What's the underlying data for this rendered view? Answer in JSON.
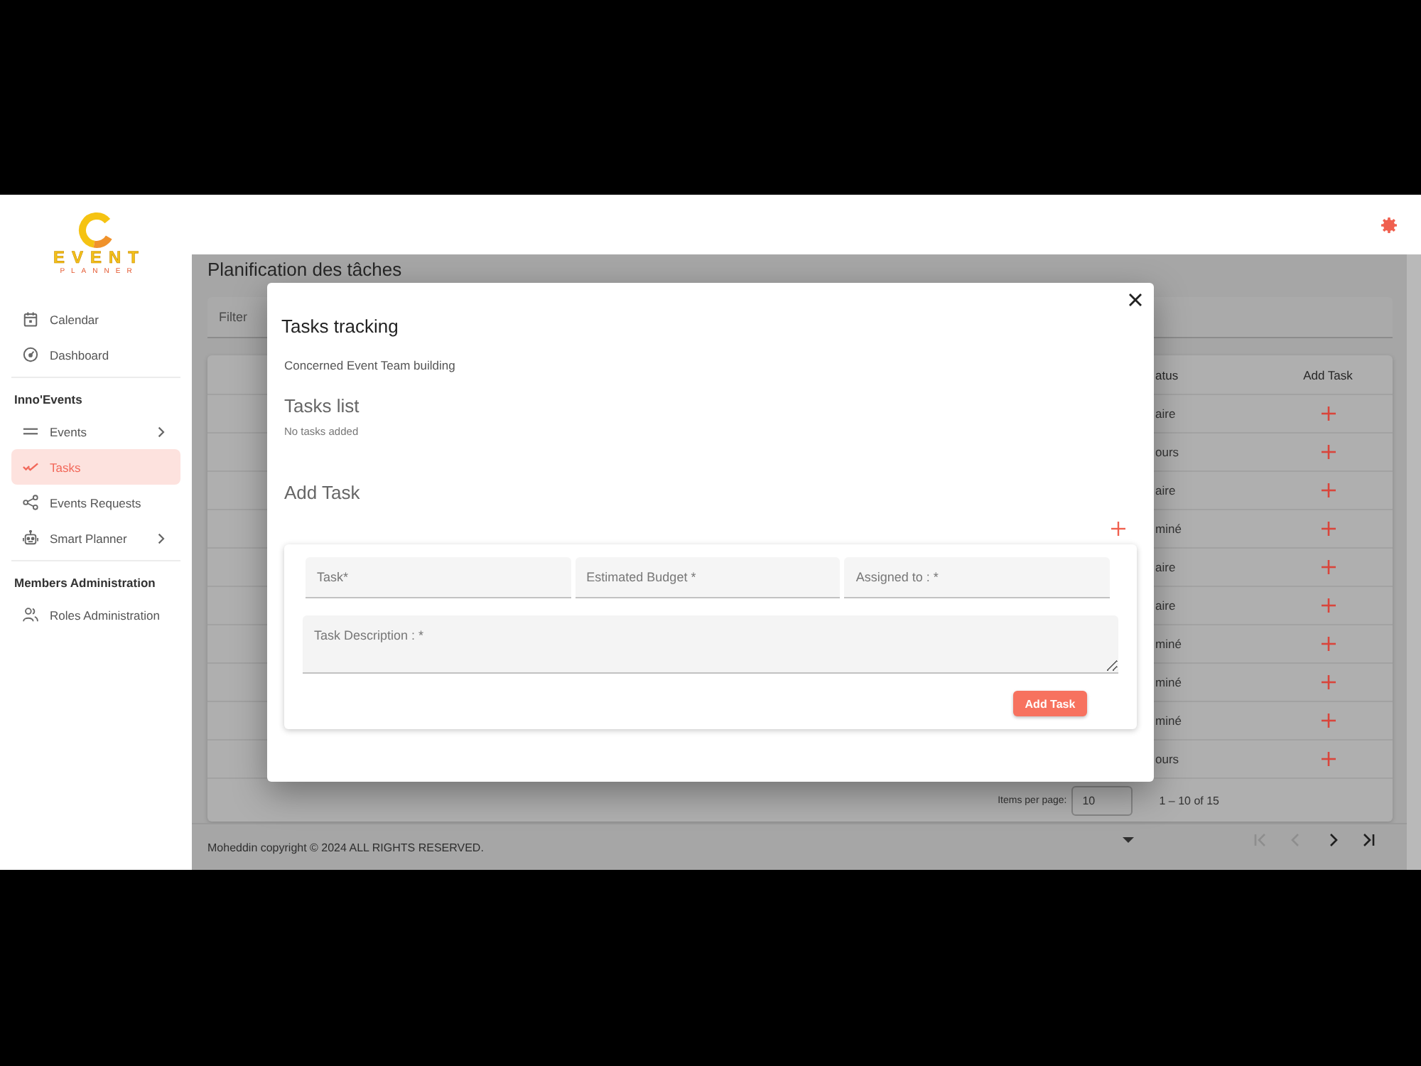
{
  "sidebar": {
    "logo": {
      "title": "EVENT",
      "subtitle": "PLANNER"
    },
    "sections": [
      {
        "items": [
          {
            "label": "Calendar",
            "selected": false,
            "expandable": false
          },
          {
            "label": "Dashboard",
            "selected": false,
            "expandable": false
          }
        ]
      },
      {
        "heading": "Inno'Events",
        "items": [
          {
            "label": "Events",
            "selected": false,
            "expandable": true
          },
          {
            "label": "Tasks",
            "selected": true,
            "expandable": false
          },
          {
            "label": "Events Requests",
            "selected": false,
            "expandable": false
          },
          {
            "label": "Smart Planner",
            "selected": false,
            "expandable": true
          }
        ]
      },
      {
        "heading": "Members Administration",
        "items": [
          {
            "label": "Roles Administration",
            "selected": false,
            "expandable": false
          }
        ]
      }
    ]
  },
  "page": {
    "title": "Planification des tâches",
    "filter": {
      "placeholder": "Filter"
    },
    "table": {
      "columns": [
        {
          "label": "atus"
        },
        {
          "label": "Add Task"
        }
      ],
      "rows": [
        {
          "column_1": "aire"
        },
        {
          "column_1": "ours"
        },
        {
          "column_1": "aire"
        },
        {
          "column_1": "miné"
        },
        {
          "column_1": "aire"
        },
        {
          "column_1": "aire"
        },
        {
          "column_1": "miné"
        },
        {
          "column_1": "miné"
        },
        {
          "column_1": "miné"
        },
        {
          "column_1": "ours"
        }
      ]
    },
    "paginator": {
      "items_per_page_label": "Items per page:",
      "page_size": "10",
      "range": "1 – 10 of 15",
      "nav": [
        {
          "disabled": true
        },
        {
          "disabled": true
        },
        {
          "disabled": false
        },
        {
          "disabled": false
        }
      ]
    }
  },
  "footer": {
    "text": "Moheddin copyright © 2024 ALL RIGHTS RESERVED."
  },
  "dialog": {
    "title": "Tasks tracking",
    "event_line": "Concerned Event Team building",
    "tasks_list": {
      "heading": "Tasks list",
      "empty_text": "No tasks added"
    },
    "add_task": {
      "heading": "Add Task",
      "fields": [
        {
          "placeholder": "Task*"
        },
        {
          "placeholder": "Estimated Budget *"
        },
        {
          "placeholder": "Assigned to : *"
        }
      ],
      "description": {
        "placeholder": "Task Description : *"
      },
      "submit": "Add Task"
    }
  }
}
